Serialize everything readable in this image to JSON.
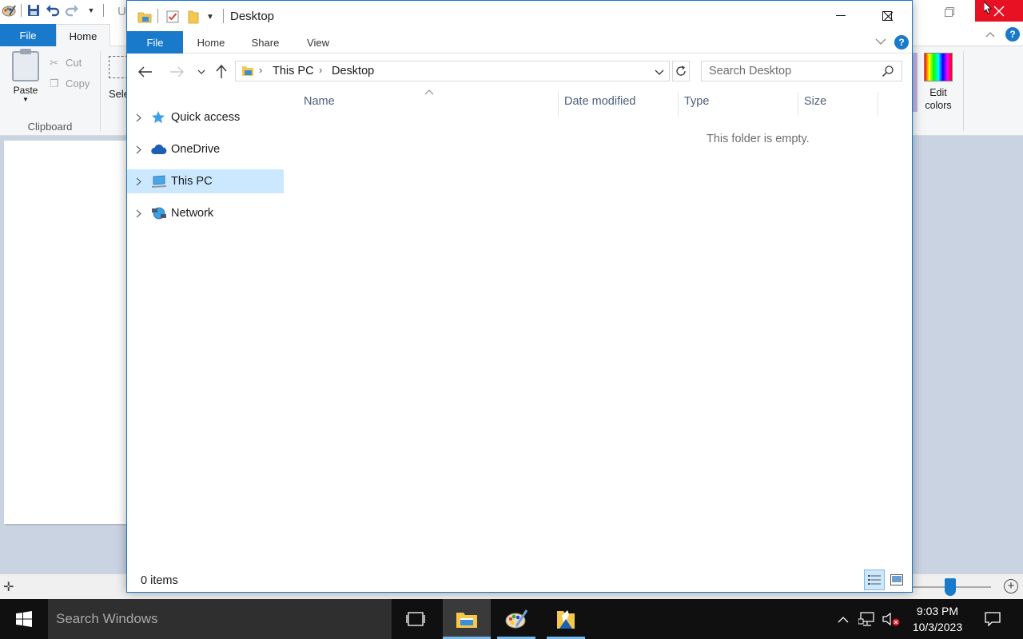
{
  "paint": {
    "title_fragment": "U",
    "tabs": {
      "file": "File",
      "home": "Home"
    },
    "clipboard": {
      "paste": "Paste",
      "cut": "Cut",
      "copy": "Copy",
      "group_label": "Clipboard"
    },
    "select_fragment": "Sele",
    "edit_colors": "Edit colors"
  },
  "explorer": {
    "title": "Desktop",
    "ribbon_tabs": {
      "file": "File",
      "home": "Home",
      "share": "Share",
      "view": "View"
    },
    "breadcrumb": [
      "This PC",
      "Desktop"
    ],
    "search_placeholder": "Search Desktop",
    "nav_items": [
      {
        "label": "Quick access",
        "icon": "star-icon",
        "selected": false
      },
      {
        "label": "OneDrive",
        "icon": "cloud-icon",
        "selected": false
      },
      {
        "label": "This PC",
        "icon": "computer-icon",
        "selected": true
      },
      {
        "label": "Network",
        "icon": "network-icon",
        "selected": false
      }
    ],
    "columns": [
      "Name",
      "Date modified",
      "Type",
      "Size"
    ],
    "sort_column": "Name",
    "empty_message": "This folder is empty.",
    "status_count": "0 items"
  },
  "taskbar": {
    "search_placeholder": "Search Windows",
    "time": "9:03 PM",
    "date": "10/3/2023"
  },
  "colors": {
    "accent": "#1979ca",
    "selection": "#cce8ff",
    "close_red": "#e81123",
    "taskbar": "#101010"
  }
}
